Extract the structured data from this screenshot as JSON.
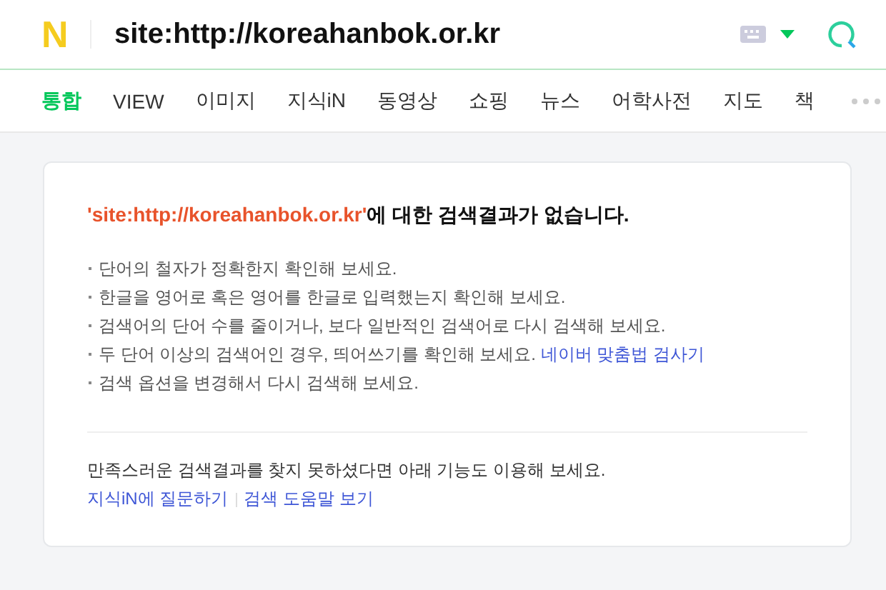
{
  "header": {
    "logo": "N",
    "query": "site:http://koreahanbok.or.kr"
  },
  "tabs": [
    {
      "label": "통합",
      "selected": true
    },
    {
      "label": "VIEW",
      "selected": false
    },
    {
      "label": "이미지",
      "selected": false
    },
    {
      "label": "지식iN",
      "selected": false
    },
    {
      "label": "동영상",
      "selected": false
    },
    {
      "label": "쇼핑",
      "selected": false
    },
    {
      "label": "뉴스",
      "selected": false
    },
    {
      "label": "어학사전",
      "selected": false
    },
    {
      "label": "지도",
      "selected": false
    },
    {
      "label": "책",
      "selected": false
    }
  ],
  "result": {
    "query_quoted": "'site:http://koreahanbok.or.kr'",
    "title_rest": "에 대한 검색결과가 없습니다.",
    "tips": [
      {
        "text": "단어의 철자가 정확한지 확인해 보세요."
      },
      {
        "text": "한글을 영어로 혹은 영어를 한글로 입력했는지 확인해 보세요."
      },
      {
        "text": "검색어의 단어 수를 줄이거나, 보다 일반적인 검색어로 다시 검색해 보세요."
      },
      {
        "text": "두 단어 이상의 검색어인 경우, 띄어쓰기를 확인해 보세요.",
        "link": "네이버 맞춤법 검사기"
      },
      {
        "text": "검색 옵션을 변경해서 다시 검색해 보세요."
      }
    ],
    "footer_text": "만족스러운 검색결과를 찾지 못하셨다면 아래 기능도 이용해 보세요.",
    "footer_links": [
      "지식iN에 질문하기",
      "검색 도움말 보기"
    ]
  }
}
